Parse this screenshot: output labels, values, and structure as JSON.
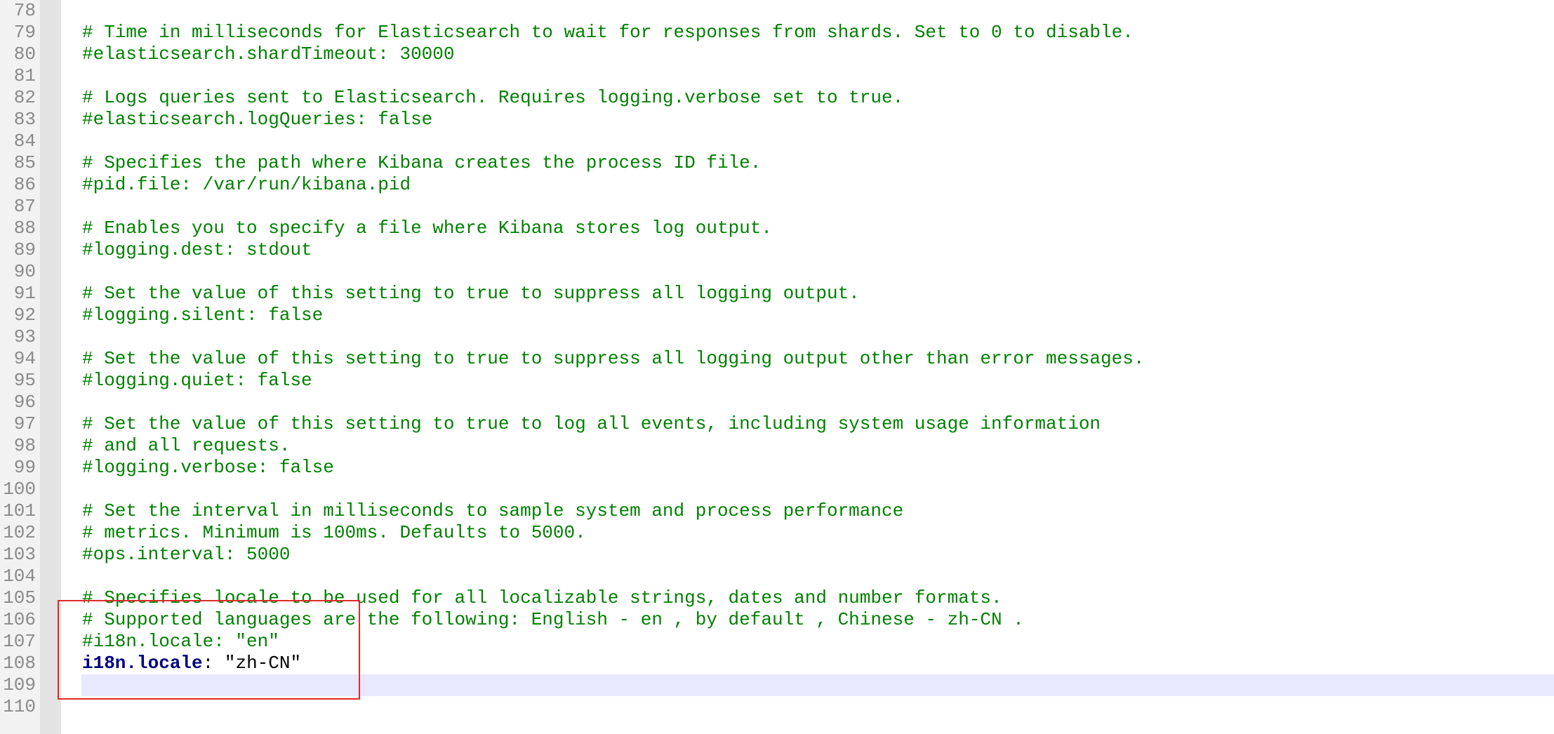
{
  "editor": {
    "lines": [
      {
        "num": "78",
        "text": ""
      },
      {
        "num": "79",
        "text": "# Time in milliseconds for Elasticsearch to wait for responses from shards. Set to 0 to disable."
      },
      {
        "num": "80",
        "text": "#elasticsearch.shardTimeout: 30000"
      },
      {
        "num": "81",
        "text": ""
      },
      {
        "num": "82",
        "text": "# Logs queries sent to Elasticsearch. Requires logging.verbose set to true."
      },
      {
        "num": "83",
        "text": "#elasticsearch.logQueries: false"
      },
      {
        "num": "84",
        "text": ""
      },
      {
        "num": "85",
        "text": "# Specifies the path where Kibana creates the process ID file."
      },
      {
        "num": "86",
        "text": "#pid.file: /var/run/kibana.pid"
      },
      {
        "num": "87",
        "text": ""
      },
      {
        "num": "88",
        "text": "# Enables you to specify a file where Kibana stores log output."
      },
      {
        "num": "89",
        "text": "#logging.dest: stdout"
      },
      {
        "num": "90",
        "text": ""
      },
      {
        "num": "91",
        "text": "# Set the value of this setting to true to suppress all logging output."
      },
      {
        "num": "92",
        "text": "#logging.silent: false"
      },
      {
        "num": "93",
        "text": ""
      },
      {
        "num": "94",
        "text": "# Set the value of this setting to true to suppress all logging output other than error messages."
      },
      {
        "num": "95",
        "text": "#logging.quiet: false"
      },
      {
        "num": "96",
        "text": ""
      },
      {
        "num": "97",
        "text": "# Set the value of this setting to true to log all events, including system usage information"
      },
      {
        "num": "98",
        "text": "# and all requests."
      },
      {
        "num": "99",
        "text": "#logging.verbose: false"
      },
      {
        "num": "100",
        "text": ""
      },
      {
        "num": "101",
        "text": "# Set the interval in milliseconds to sample system and process performance"
      },
      {
        "num": "102",
        "text": "# metrics. Minimum is 100ms. Defaults to 5000."
      },
      {
        "num": "103",
        "text": "#ops.interval: 5000"
      },
      {
        "num": "104",
        "text": ""
      },
      {
        "num": "105",
        "text": "# Specifies locale to be used for all localizable strings, dates and number formats."
      },
      {
        "num": "106",
        "text": "# Supported languages are the following: English - en , by default , Chinese - zh-CN ."
      },
      {
        "num": "107",
        "text": "#i18n.locale: \"en\""
      },
      {
        "num": "108",
        "key": "i18n.locale",
        "sep": ": ",
        "value": "\"zh-CN\""
      },
      {
        "num": "109",
        "text": ""
      },
      {
        "num": "110",
        "text": ""
      }
    ]
  },
  "colors": {
    "comment": "#008000",
    "key": "#000080",
    "line_number": "#8a8a8a",
    "current_line": "#e8e8ff",
    "annotation_box": "#e0282b"
  }
}
